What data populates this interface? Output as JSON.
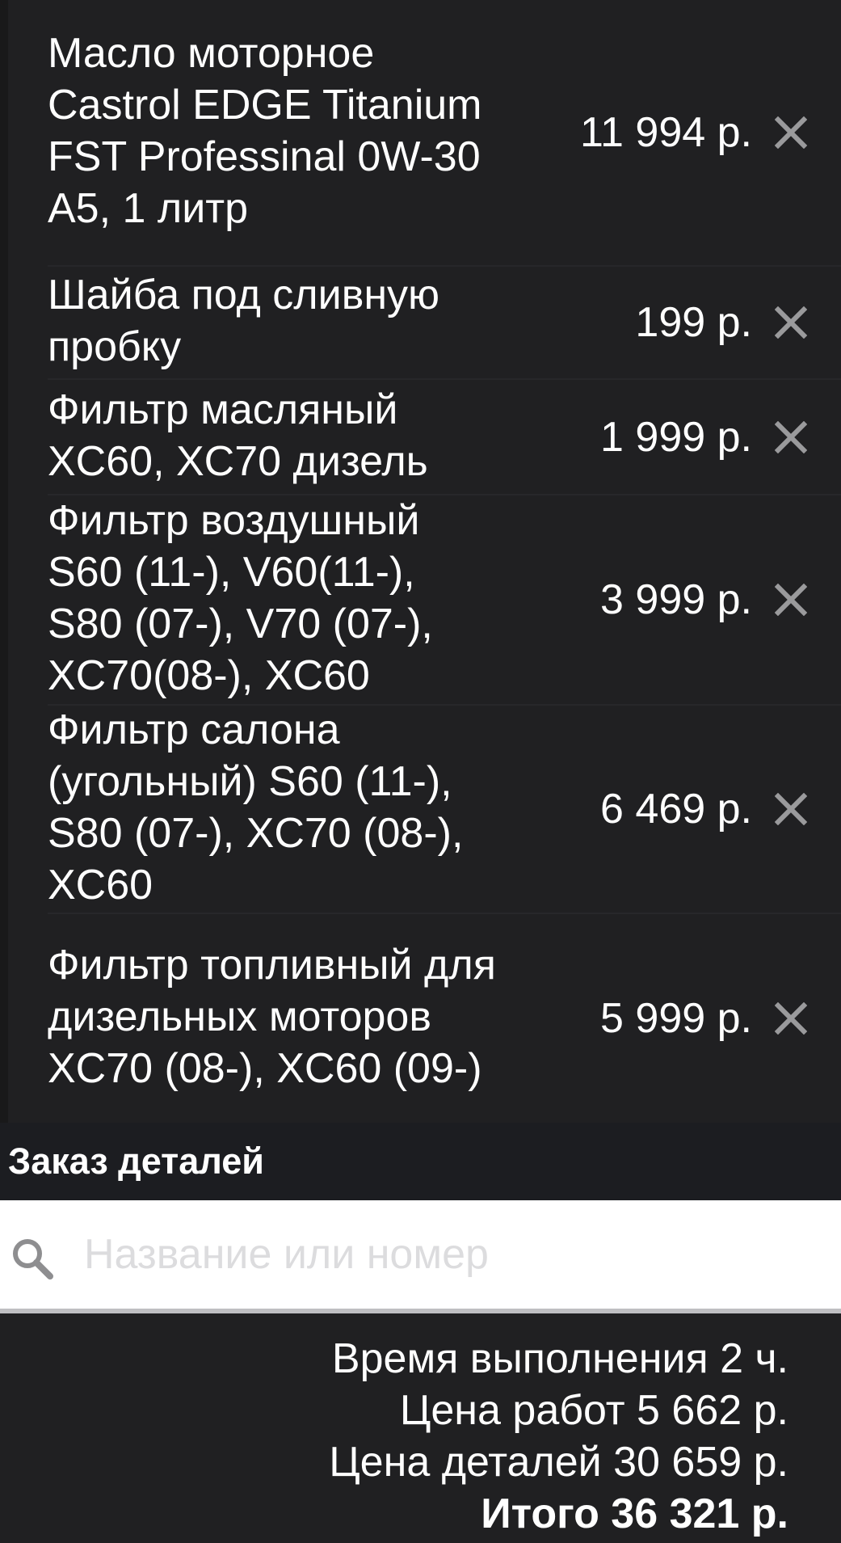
{
  "items": [
    {
      "name": "Масло моторное Castrol EDGE Titanium FST Professinal 0W-30 A5, 1 литр",
      "price": "11 994 р."
    },
    {
      "name": "Шайба под сливную пробку",
      "price": "199 р."
    },
    {
      "name": "Фильтр масляный XC60, XC70 дизель",
      "price": "1 999 р."
    },
    {
      "name": "Фильтр воздушный S60 (11-), V60(11-), S80 (07-), V70 (07-), XC70(08-), XC60",
      "price": "3 999 р."
    },
    {
      "name": "Фильтр салона (угольный) S60 (11-), S80 (07-), XC70 (08-), XC60",
      "price": "6 469 р."
    },
    {
      "name": "Фильтр топливный для дизельных моторов XC70 (08-), XC60 (09-)",
      "price": "5 999 р."
    }
  ],
  "section": {
    "title": "Заказ деталей"
  },
  "search": {
    "placeholder": "Название или номер",
    "value": ""
  },
  "summary": {
    "time": "Время выполнения 2 ч.",
    "work_price": "Цена работ 5 662 р.",
    "parts_price": "Цена деталей 30 659 р.",
    "total": "Итого 36 321 р."
  },
  "icons": {
    "remove": "close-icon",
    "search": "search-icon"
  },
  "colors": {
    "background": "#202022",
    "header": "#1c1d21",
    "icon_gray": "#9a9a9c"
  }
}
